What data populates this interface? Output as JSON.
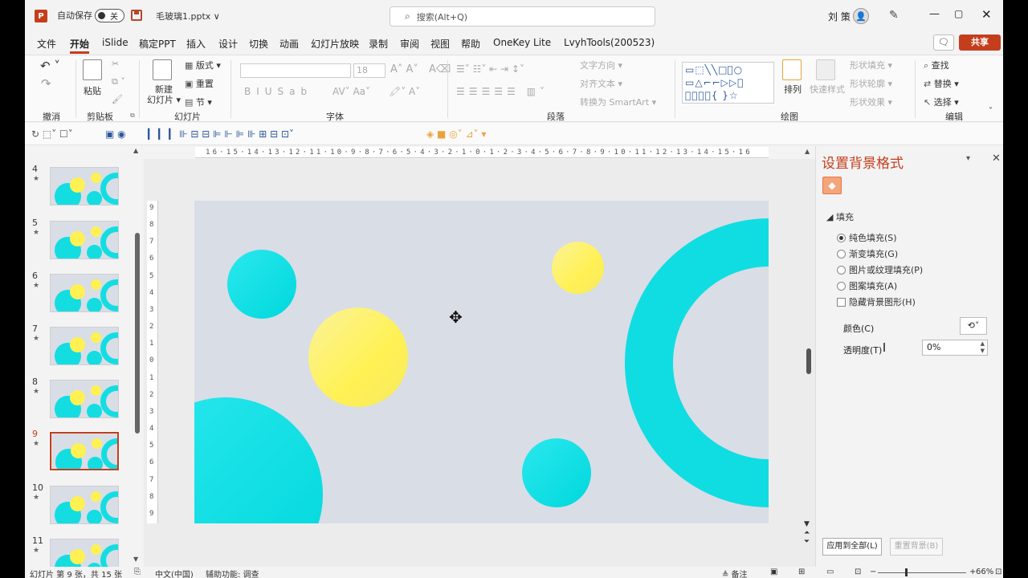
{
  "titlebar": {
    "app_logo": "P",
    "autosave_label": "自动保存",
    "autosave_state": "关",
    "doc_title": "毛玻璃1.pptx ∨",
    "search_placeholder": "搜索(Alt+Q)",
    "user_name": "刘 策",
    "icons": [
      "powerpoint-logo",
      "save-icon",
      "search-icon",
      "avatar",
      "pen-icon",
      "minimize",
      "maximize",
      "close"
    ]
  },
  "menu": {
    "tabs": [
      "文件",
      "开始",
      "iSlide",
      "稿定PPT",
      "插入",
      "设计",
      "切换",
      "动画",
      "幻灯片放映",
      "录制",
      "审阅",
      "视图",
      "帮助",
      "OneKey Lite",
      "LvyhTools(200523)"
    ],
    "active": "开始",
    "share_label": "共享",
    "comment_icon": "comment-icon"
  },
  "ribbon": {
    "groups": {
      "undo": "撤消",
      "clipboard": "剪贴板",
      "slides": "幻灯片",
      "font": "字体",
      "paragraph": "段落",
      "drawing": "绘图",
      "editing": "编辑"
    },
    "paste_label": "粘贴",
    "new_slide_label": "新建",
    "new_slide_label2": "幻灯片 ▾",
    "layout_label": "版式 ▾",
    "reset_label": "重置",
    "section_label": "节 ▾",
    "font_size": "18",
    "text_direction": "文字方向 ▾",
    "align_text": "对齐文本 ▾",
    "smartart": "转换为 SmartArt ▾",
    "arrange_label": "排列",
    "quick_styles_label": "快速样式",
    "shape_fill": "形状填充 ▾",
    "shape_outline": "形状轮廓 ▾",
    "shape_effects": "形状效果 ▾",
    "find_label": "查找",
    "replace_label": "替换 ▾",
    "select_label": "选择 ▾",
    "shapes_gallery": "▭⬚╲╲□⃝○ ▭△⌐⌐▷▷⌒ ⌒⌒⌒⌒{ }☆"
  },
  "thumbnails": [
    {
      "num": "4",
      "star": "★"
    },
    {
      "num": "5",
      "star": "★"
    },
    {
      "num": "6",
      "star": "★"
    },
    {
      "num": "7",
      "star": "★"
    },
    {
      "num": "8",
      "star": "★"
    },
    {
      "num": "9",
      "star": "★",
      "selected": true
    },
    {
      "num": "10",
      "star": "★"
    },
    {
      "num": "11",
      "star": "★"
    }
  ],
  "ruler": {
    "horizontal": "16·15·14·13·12·11·10·9·8·7·6·5·4·3·2·1·0·1·2·3·4·5·6·7·8·9·10·11·12·13·14·15·16",
    "vertical": [
      "9",
      "8",
      "7",
      "6",
      "5",
      "4",
      "3",
      "2",
      "1",
      "0",
      "1",
      "2",
      "3",
      "4",
      "5",
      "6",
      "7",
      "8",
      "9"
    ]
  },
  "format_pane": {
    "title": "设置背景格式",
    "section": "填充",
    "options": [
      {
        "label": "纯色填充(S)",
        "type": "radio",
        "checked": true
      },
      {
        "label": "渐变填充(G)",
        "type": "radio",
        "checked": false
      },
      {
        "label": "图片或纹理填充(P)",
        "type": "radio",
        "checked": false
      },
      {
        "label": "图案填充(A)",
        "type": "radio",
        "checked": false
      },
      {
        "label": "隐藏背景图形(H)",
        "type": "checkbox",
        "checked": false
      }
    ],
    "color_label": "颜色(C)",
    "transparency_label": "透明度(T)",
    "transparency_value": "0%",
    "apply_all": "应用到全部(L)",
    "reset_background": "重置背景(B)"
  },
  "status": {
    "slide_info": "幻灯片 第 9 张，共 15 张",
    "language": "中文(中国)",
    "accessibility": "辅助功能: 调查",
    "notes": "≜ 备注",
    "zoom": "66%"
  },
  "colors": {
    "accent": "#c43e1c",
    "slide_bg": "#d9dde6",
    "cyan": "#10dde2",
    "yellow": "#fff154"
  }
}
